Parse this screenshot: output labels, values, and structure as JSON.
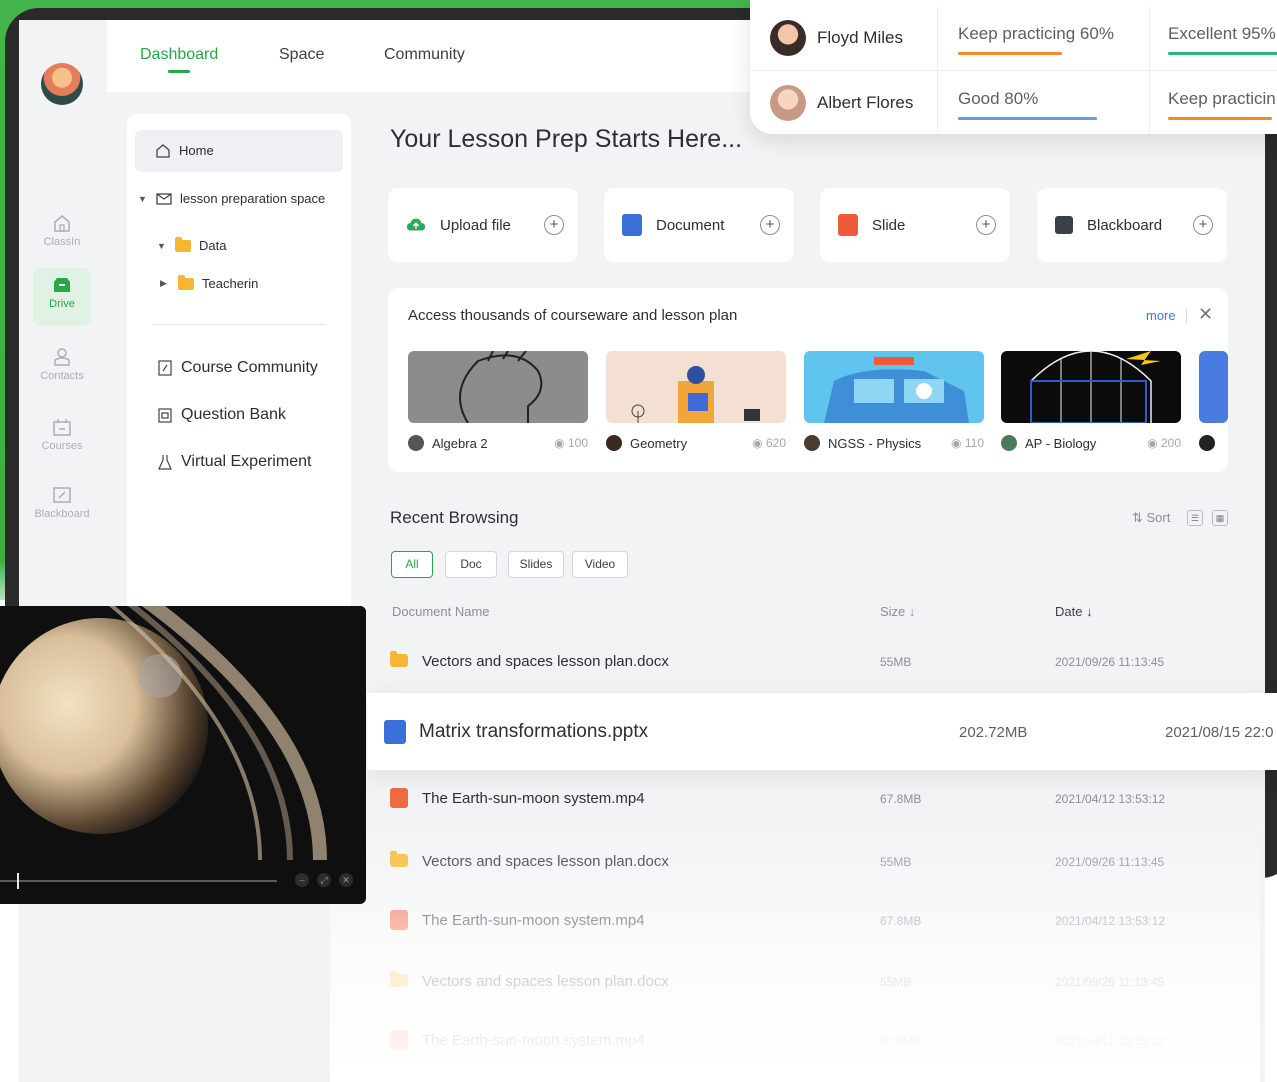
{
  "nav": {
    "tabs": [
      {
        "label": "Dashboard",
        "active": true
      },
      {
        "label": "Space",
        "active": false
      },
      {
        "label": "Community",
        "active": false
      }
    ]
  },
  "rail": {
    "items": [
      {
        "label": "ClassIn",
        "icon": "home-icon",
        "active": false
      },
      {
        "label": "Drive",
        "icon": "drive-icon",
        "active": true
      },
      {
        "label": "Contacts",
        "icon": "contacts-icon",
        "active": false
      },
      {
        "label": "Courses",
        "icon": "courses-icon",
        "active": false
      },
      {
        "label": "Blackboard",
        "icon": "blackboard-icon",
        "active": false
      }
    ]
  },
  "tree": {
    "home": "Home",
    "space": "lesson preparation space",
    "folders": [
      "Data",
      "Teacherin"
    ],
    "links": [
      "Course Community",
      "Question Bank",
      "Virtual Experiment"
    ]
  },
  "main": {
    "title": "Your Lesson Prep Starts Here...",
    "actions": [
      {
        "label": "Upload file",
        "icon": "cloud-upload-icon",
        "color": "#2fa85a"
      },
      {
        "label": "Document",
        "icon": "document-icon",
        "color": "#3a6fd8"
      },
      {
        "label": "Slide",
        "icon": "slide-icon",
        "color": "#ee5b3a"
      },
      {
        "label": "Blackboard",
        "icon": "blackboard-icon",
        "color": "#3b3f46"
      }
    ]
  },
  "courseware": {
    "title": "Access thousands of courseware and lesson plan",
    "more": "more",
    "items": [
      {
        "name": "Algebra 2",
        "views": "100"
      },
      {
        "name": "Geometry",
        "views": "620"
      },
      {
        "name": "NGSS - Physics",
        "views": "110"
      },
      {
        "name": "AP - Biology",
        "views": "200"
      }
    ]
  },
  "recent": {
    "title": "Recent Browsing",
    "sort": "Sort",
    "filters": [
      "All",
      "Doc",
      "Slides",
      "Video"
    ],
    "columns": {
      "name": "Document Name",
      "size": "Size",
      "date": "Date"
    },
    "rows": [
      {
        "name": "Vectors and spaces lesson plan.docx",
        "size": "55MB",
        "date": "2021/09/26 11:13:45",
        "type": "folder"
      },
      {
        "name": "Matrix transformations.pptx",
        "size": "202.72MB",
        "date": "2021/08/15 22:0",
        "type": "doc"
      },
      {
        "name": "The Earth-sun-moon system.mp4",
        "size": "67.8MB",
        "date": "2021/04/12 13:53:12",
        "type": "video"
      },
      {
        "name": "Vectors and spaces lesson plan.docx",
        "size": "55MB",
        "date": "2021/09/26 11:13:45",
        "type": "folder"
      },
      {
        "name": "The Earth-sun-moon system.mp4",
        "size": "67.8MB",
        "date": "2021/04/12 13:53:12",
        "type": "video"
      },
      {
        "name": "Vectors and spaces lesson plan.docx",
        "size": "55MB",
        "date": "2021/09/26 11:13:45",
        "type": "folder"
      },
      {
        "name": "The Earth-sun-moon system.mp4",
        "size": "67.8MB",
        "date": "2021/04/12 13:53:12",
        "type": "video"
      }
    ]
  },
  "grades": {
    "students": [
      {
        "name": "Floyd Miles",
        "c1": "Keep practicing 60%",
        "c1_progress": 0.6,
        "c1_color": "#f08a2b",
        "c2": "Excellent  95%",
        "c2_progress": 0.95,
        "c2_color": "#2bb673"
      },
      {
        "name": "Albert Flores",
        "c1": "Good  80%",
        "c1_progress": 0.8,
        "c1_color": "#6f93e6",
        "c2": "Keep practicin",
        "c2_progress": 0.6,
        "c2_color": "#f08a2b"
      }
    ]
  },
  "colors": {
    "accent": "#27a74a",
    "green_bg": "#43b44c"
  }
}
